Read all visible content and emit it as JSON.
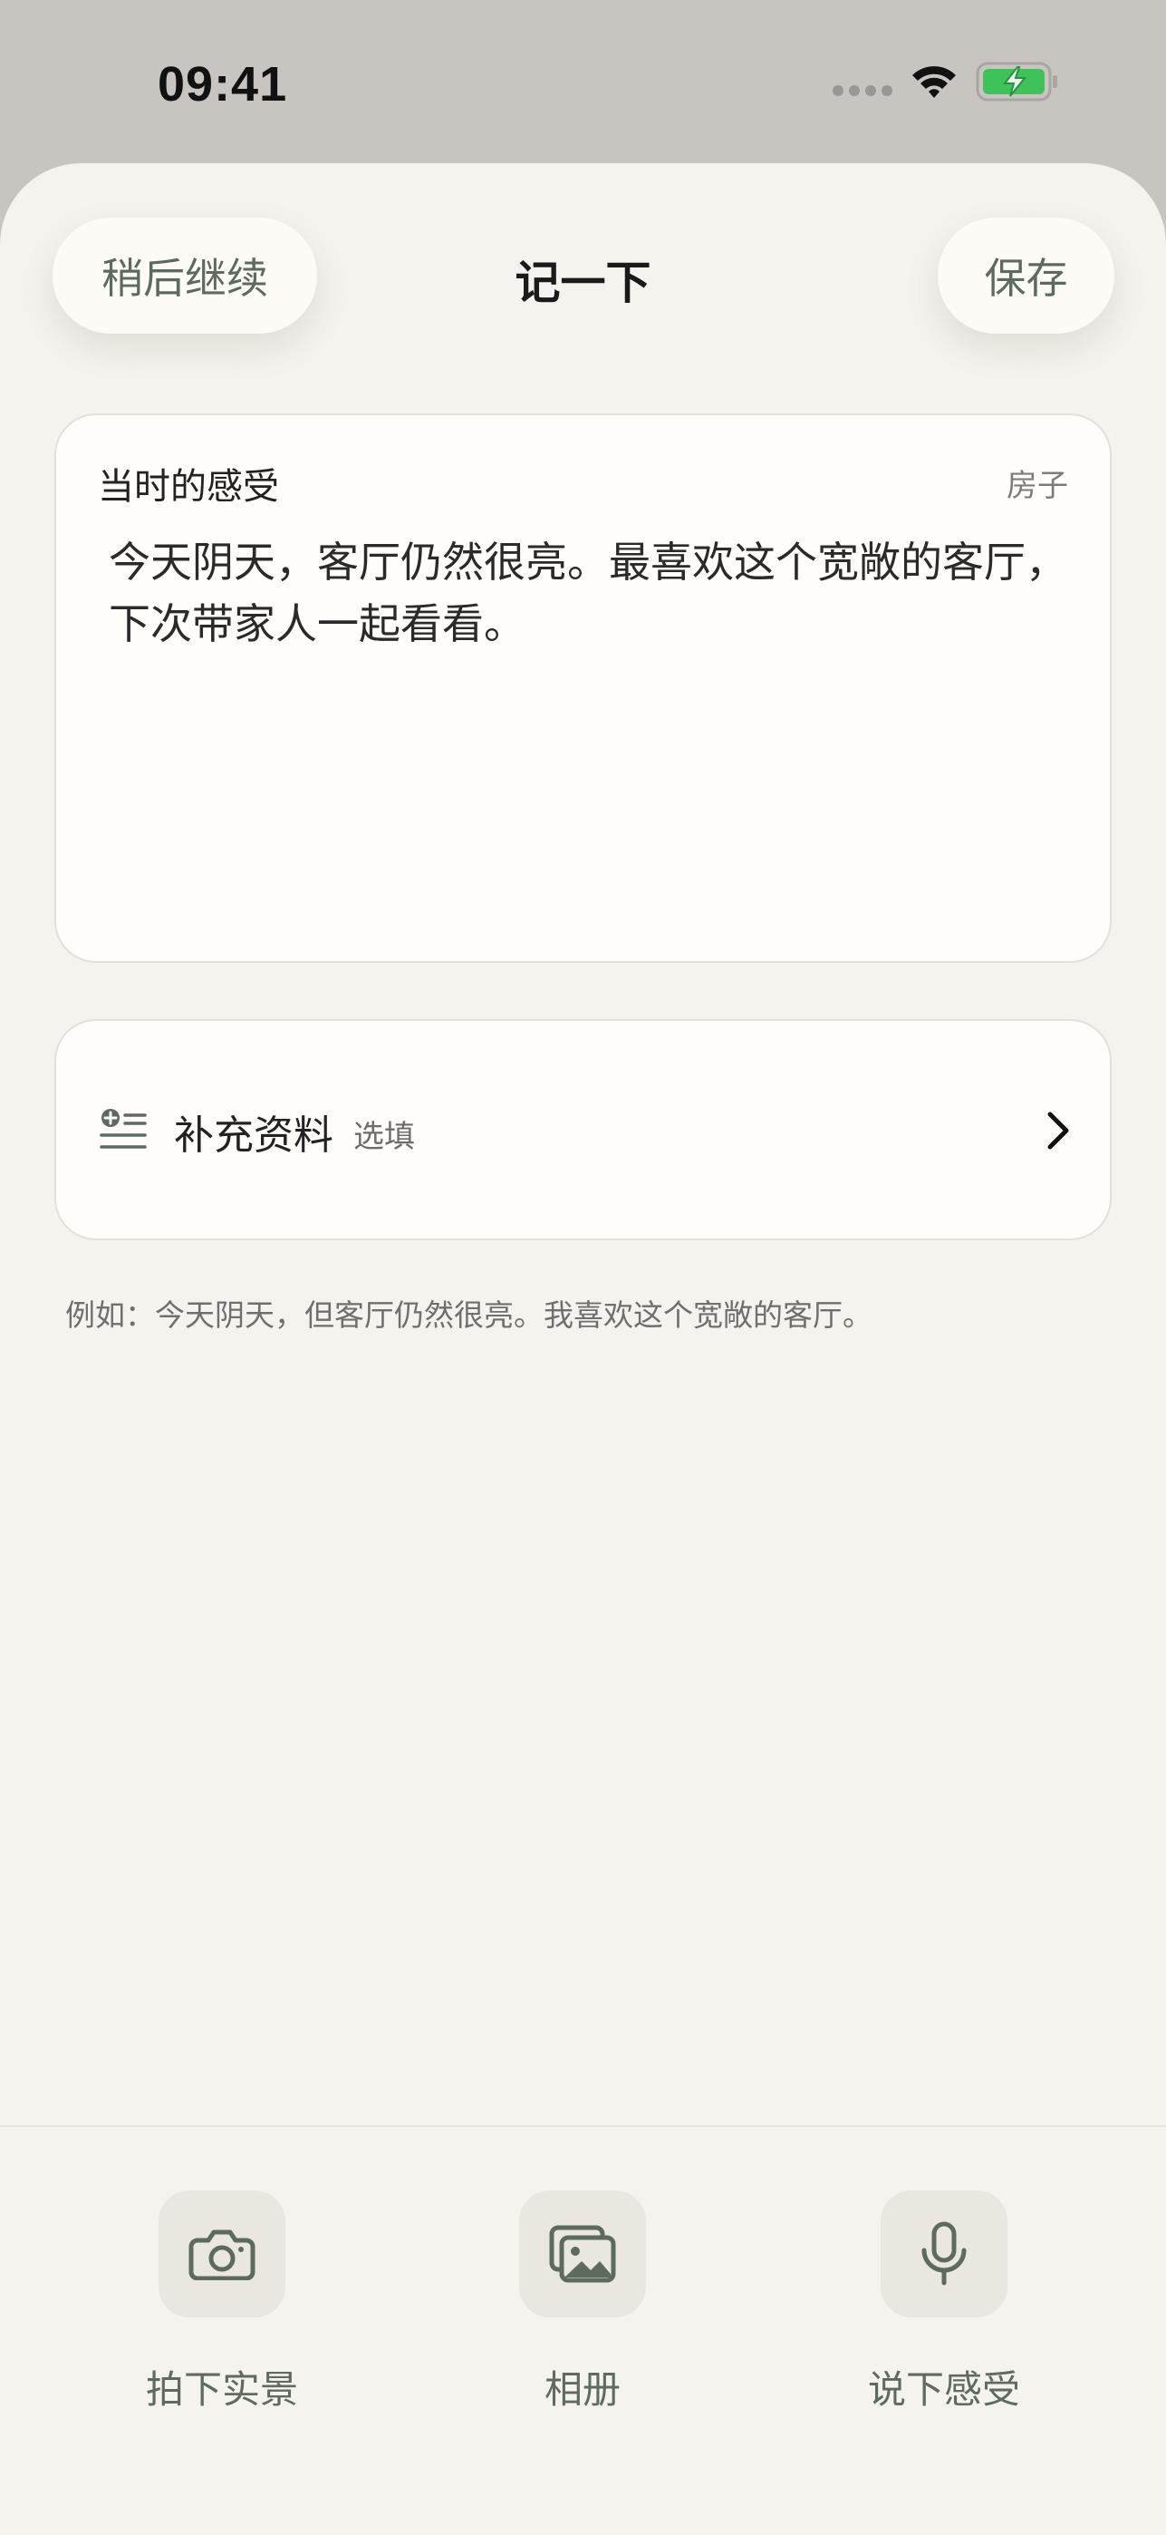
{
  "status_bar": {
    "time": "09:41"
  },
  "nav": {
    "left_button": "稍后继续",
    "title": "记一下",
    "right_button": "保存"
  },
  "feeling_card": {
    "label": "当时的感受",
    "tag": "房子",
    "text": "今天阴天，客厅仍然很亮。最喜欢这个宽敞的客厅，下次带家人一起看看。"
  },
  "extra_card": {
    "icon": "list-add-icon",
    "title": "补充资料",
    "optional": "选填"
  },
  "hint": "例如：今天阴天，但客厅仍然很亮。我喜欢这个宽敞的客厅。",
  "actions": [
    {
      "label": "拍下实景",
      "icon": "camera-icon"
    },
    {
      "label": "相册",
      "icon": "gallery-icon"
    },
    {
      "label": "说下感受",
      "icon": "microphone-icon"
    }
  ],
  "colors": {
    "background": "#f5f3ee",
    "card": "#fefdf9",
    "accent": "#5d6b5e",
    "battery": "#3dc35a"
  }
}
